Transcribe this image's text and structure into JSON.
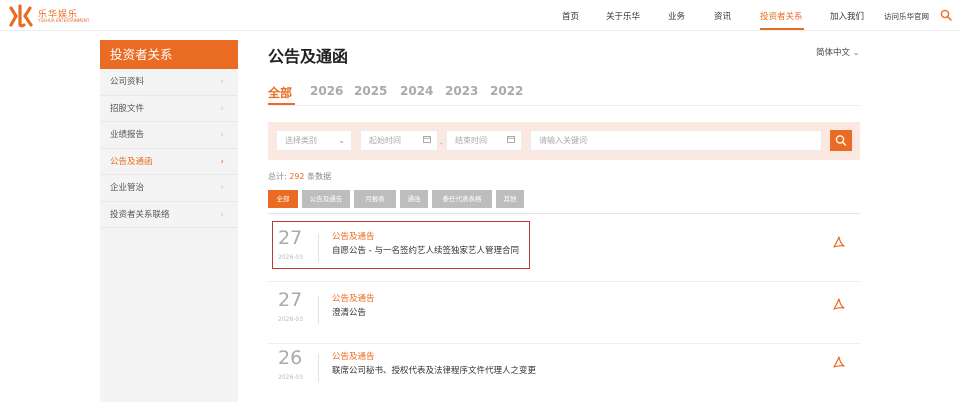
{
  "header": {
    "logo_cn": "乐华娱乐",
    "logo_en": "YUEHUA ENTERTAINMENT",
    "nav": [
      "首页",
      "关于乐华",
      "业务",
      "资讯",
      "投资者关系",
      "加入我们",
      "访问乐华官网"
    ],
    "active_nav": "投资者关系"
  },
  "sidebar": {
    "title": "投资者关系",
    "items": [
      {
        "label": "公司资料"
      },
      {
        "label": "招股文件"
      },
      {
        "label": "业绩报告"
      },
      {
        "label": "公告及通函"
      },
      {
        "label": "企业管治"
      },
      {
        "label": "投资者关系联络"
      }
    ],
    "active_item": "公告及通函"
  },
  "main": {
    "title": "公告及通函",
    "language": "简体中文",
    "years": [
      "全部",
      "2026",
      "2025",
      "2024",
      "2023",
      "2022"
    ],
    "active_year": "全部",
    "filter": {
      "category_placeholder": "选择类别",
      "start_placeholder": "起始时间",
      "end_placeholder": "结束时间",
      "separator": "-",
      "keyword_placeholder": "请输入关键词"
    },
    "total_prefix": "总计:",
    "total_count": "292",
    "total_suffix": "条数据",
    "category_tabs": [
      "全部",
      "公告及通告",
      "月报表",
      "通函",
      "委任代表表格",
      "其他"
    ],
    "active_category": "全部",
    "rows": [
      {
        "day": "27",
        "ym": "2026-03",
        "category": "公告及通告",
        "title": "自愿公告 - 与一名签约艺人续签独家艺人管理合同"
      },
      {
        "day": "27",
        "ym": "2026-03",
        "category": "公告及通告",
        "title": "澄清公告"
      },
      {
        "day": "26",
        "ym": "2026-03",
        "category": "公告及通告",
        "title": "联席公司秘书、授权代表及法律程序文件代理人之变更"
      }
    ]
  },
  "colors": {
    "accent": "#ea6c24",
    "highlight": "#c0392b",
    "sidebar_bg": "#f4f4f4",
    "filter_bg": "#fbe9e1"
  },
  "icons": [
    "yuehua-logo-icon",
    "search-icon",
    "chevron-down-icon",
    "chevron-right-icon",
    "calendar-icon",
    "pdf-icon"
  ]
}
